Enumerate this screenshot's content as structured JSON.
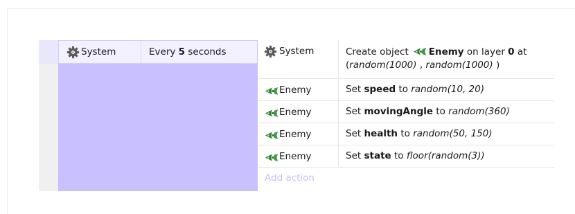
{
  "event": {
    "condition": {
      "object_icon": "gear-icon",
      "object_label": "System",
      "text_pre": "Every ",
      "text_value": "5",
      "text_post": " seconds"
    },
    "actions": [
      {
        "object_icon": "gear-icon",
        "object_label": "System",
        "line1": {
          "pre": "Create object",
          "object_icon": "enemy-sprite-icon",
          "object": "Enemy",
          "mid": " on layer ",
          "layer": "0",
          "post": " at"
        },
        "line2": {
          "open": "(",
          "arg1": "random(1000)",
          "sep": " , ",
          "arg2": "random(1000)",
          "close": " )"
        }
      },
      {
        "object_icon": "enemy-sprite-icon",
        "object_label": "Enemy",
        "pre": "Set ",
        "variable": "speed",
        "to": " to ",
        "expression": "random(10, 20)"
      },
      {
        "object_icon": "enemy-sprite-icon",
        "object_label": "Enemy",
        "pre": "Set ",
        "variable": "movingAngle",
        "to": " to ",
        "expression": "random(360)"
      },
      {
        "object_icon": "enemy-sprite-icon",
        "object_label": "Enemy",
        "pre": "Set ",
        "variable": "health",
        "to": " to ",
        "expression": "random(50, 150)"
      },
      {
        "object_icon": "enemy-sprite-icon",
        "object_label": "Enemy",
        "pre": "Set ",
        "variable": "state",
        "to": " to ",
        "expression": "floor(random(3))"
      }
    ],
    "add_action_label": "Add action"
  },
  "colors": {
    "condition_panel": "#c8c0ff",
    "condition_row": "#f3f1ff",
    "add_action_text": "#c7c1f5",
    "enemy_icon": "#2e7d32",
    "gear_icon": "#555555"
  }
}
